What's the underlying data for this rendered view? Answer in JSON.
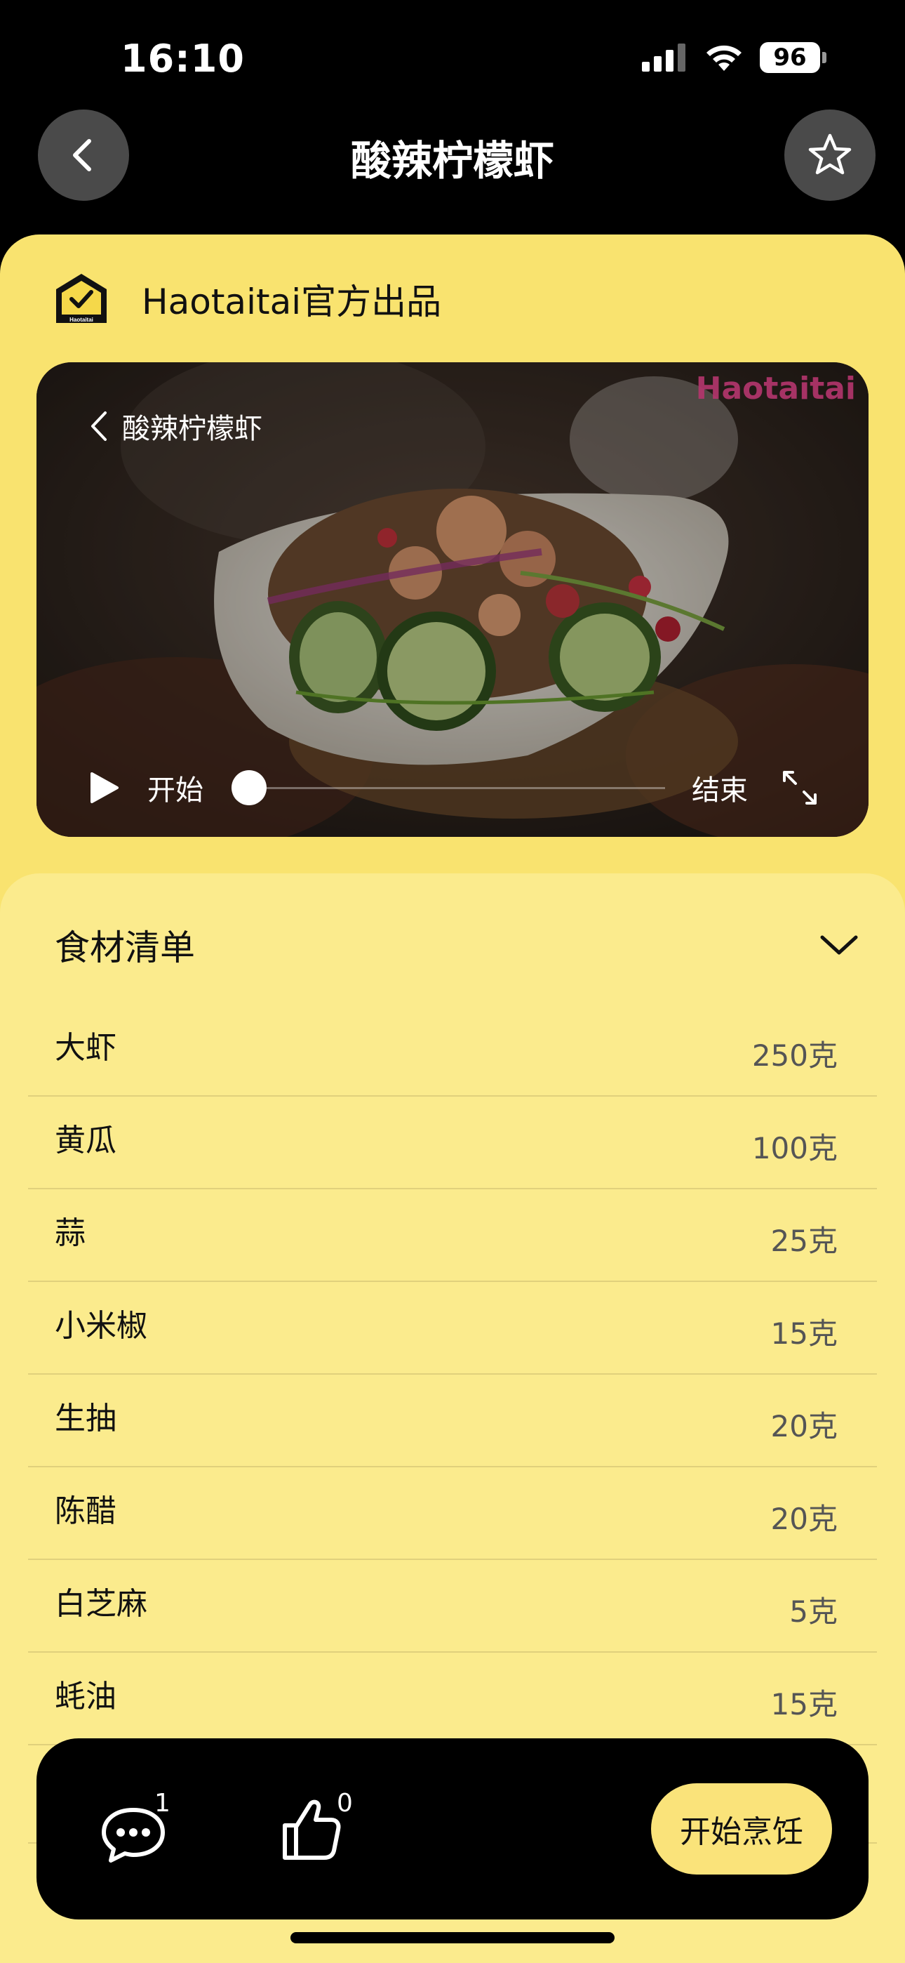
{
  "status": {
    "time": "16:10",
    "battery": "96"
  },
  "nav": {
    "title": "酸辣柠檬虾",
    "back_icon": "chevron-left-icon",
    "favorite_icon": "star-icon"
  },
  "brand": {
    "name": "Haotaitai官方出品",
    "logo_text": "Haotaitai"
  },
  "video": {
    "title": "酸辣柠檬虾",
    "watermark": "Haotaitai",
    "start_label": "开始",
    "end_label": "结束",
    "progress": 0
  },
  "ingredients": {
    "title": "食材清单",
    "items": [
      {
        "name": "大虾",
        "amount": "250克"
      },
      {
        "name": "黄瓜",
        "amount": "100克"
      },
      {
        "name": "蒜",
        "amount": "25克"
      },
      {
        "name": "小米椒",
        "amount": "15克"
      },
      {
        "name": "生抽",
        "amount": "20克"
      },
      {
        "name": "陈醋",
        "amount": "20克"
      },
      {
        "name": "白芝麻",
        "amount": "5克"
      },
      {
        "name": "蚝油",
        "amount": "15克"
      }
    ]
  },
  "actions": {
    "comment_count": "1",
    "like_count": "0",
    "cook_label": "开始烹饪"
  },
  "colors": {
    "sheet": "#f9e36f",
    "panel": "#fbeb8d",
    "button": "#fae37a"
  }
}
